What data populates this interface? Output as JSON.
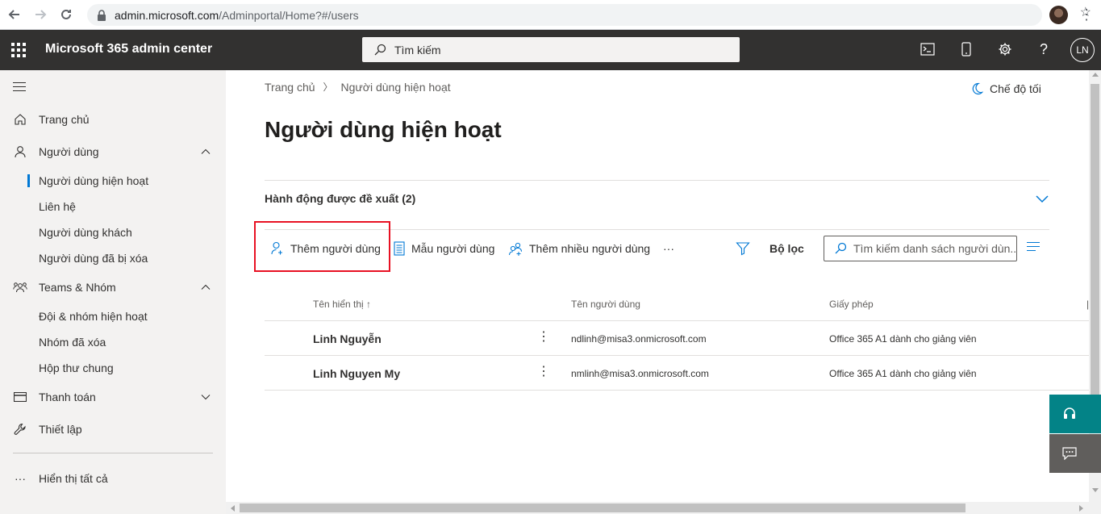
{
  "browser": {
    "url_host": "admin.microsoft.com",
    "url_path": "/Adminportal/Home?#/users"
  },
  "suite": {
    "app_title": "Microsoft 365 admin center",
    "search_placeholder": "Tìm kiếm",
    "avatar_initials": "LN",
    "help_label": "?"
  },
  "leftnav": {
    "items": [
      {
        "label": "Trang chủ"
      },
      {
        "label": "Người dùng"
      },
      {
        "label": "Người dùng hiện hoạt"
      },
      {
        "label": "Liên hệ"
      },
      {
        "label": "Người dùng khách"
      },
      {
        "label": "Người dùng đã bị xóa"
      },
      {
        "label": "Teams & Nhóm"
      },
      {
        "label": "Đội & nhóm hiện hoạt"
      },
      {
        "label": "Nhóm đã xóa"
      },
      {
        "label": "Hộp thư chung"
      },
      {
        "label": "Thanh toán"
      },
      {
        "label": "Thiết lập"
      },
      {
        "label": "Hiển thị tất cả"
      }
    ]
  },
  "main": {
    "breadcrumb": [
      "Trang chủ",
      "Người dùng hiện hoạt"
    ],
    "dark_mode": "Chế độ tối",
    "title": "Người dùng hiện hoạt",
    "suggested_actions": "Hành động được đề xuất (2)",
    "commands": {
      "add_user": "Thêm người dùng",
      "user_templates": "Mẫu người dùng",
      "add_multiple": "Thêm nhiều người dùng",
      "more": "···",
      "filter": "Bộ lọc"
    },
    "list_search_placeholder": "Tìm kiếm danh sách người dùn...",
    "table": {
      "headers": [
        "Tên hiển thị ↑",
        "Tên người dùng",
        "Giấy phép"
      ],
      "rows": [
        {
          "name": "Linh Nguyễn",
          "username": "ndlinh@misa3.onmicrosoft.com",
          "license": "Office 365 A1 dành cho giảng viên"
        },
        {
          "name": "Linh Nguyen My",
          "username": "nmlinh@misa3.onmicrosoft.com",
          "license": "Office 365 A1 dành cho giảng viên"
        }
      ]
    }
  },
  "colors": {
    "suite_bg": "#323130",
    "accent": "#0078d4",
    "highlight": "#e81123",
    "help_bg": "#038387"
  }
}
